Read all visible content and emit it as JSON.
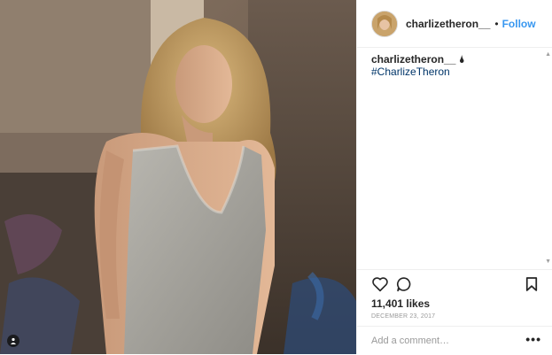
{
  "post": {
    "image_alt": "photo of a woman in a grey knit sleeveless top",
    "user_tag_icon": "user-tag-icon"
  },
  "header": {
    "username": "charlizetheron__",
    "separator": "•",
    "follow_label": "Follow",
    "follow_color": "#3897f0"
  },
  "caption": {
    "username": "charlizetheron__",
    "emoji": "🌢",
    "hashtag": "#CharlizeTheron"
  },
  "actions": {
    "like_icon": "heart-icon",
    "comment_icon": "comment-icon",
    "save_icon": "bookmark-icon"
  },
  "likes": "11,401 likes",
  "date": "DECEMBER 23, 2017",
  "comment": {
    "placeholder": "Add a comment…",
    "more_label": "•••"
  }
}
